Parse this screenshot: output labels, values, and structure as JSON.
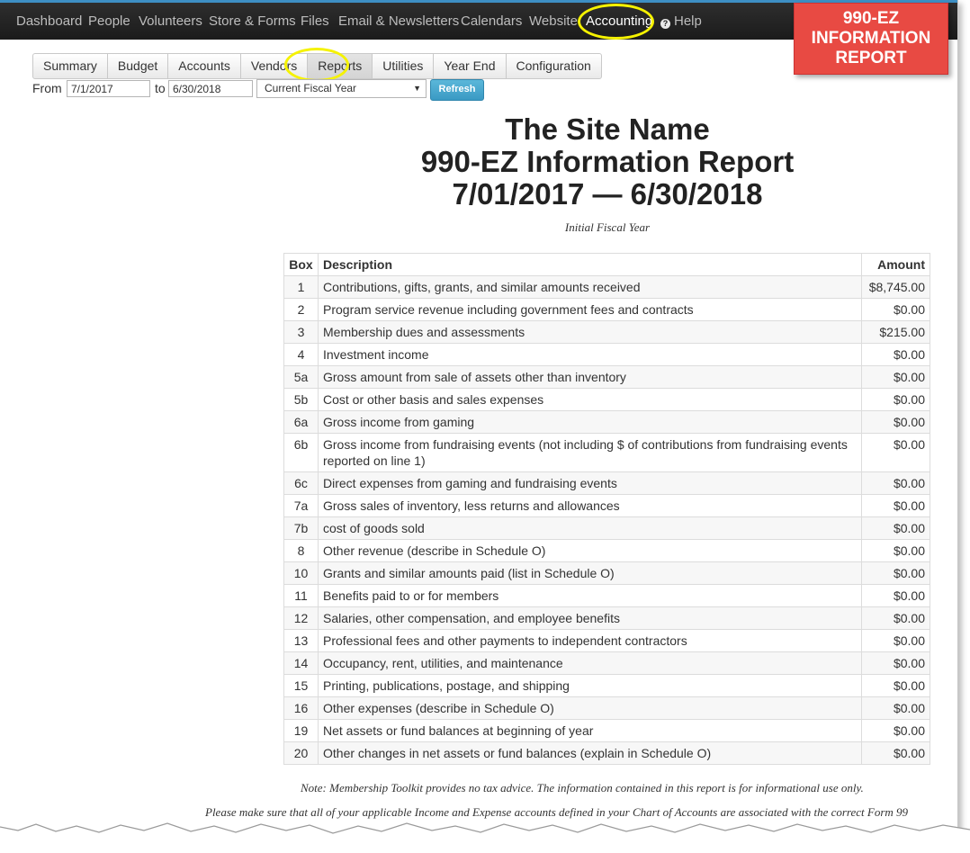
{
  "topnav": {
    "items": [
      {
        "label": "Dashboard"
      },
      {
        "label": "People"
      },
      {
        "label": "Volunteers"
      },
      {
        "label": "Store & Forms"
      },
      {
        "label": "Files"
      },
      {
        "label": "Email & Newsletters"
      },
      {
        "label": "Calendars"
      },
      {
        "label": "Website"
      },
      {
        "label": "Accounting",
        "active": true
      },
      {
        "label": "Help"
      }
    ]
  },
  "callout": {
    "line1": "990-EZ",
    "line2": "INFORMATION",
    "line3": "REPORT",
    "color": "#e84a43"
  },
  "subtabs": [
    {
      "label": "Summary"
    },
    {
      "label": "Budget"
    },
    {
      "label": "Accounts"
    },
    {
      "label": "Vendors"
    },
    {
      "label": "Reports",
      "active": true
    },
    {
      "label": "Utilities"
    },
    {
      "label": "Year End"
    },
    {
      "label": "Configuration"
    }
  ],
  "filter": {
    "from_label": "From",
    "from_value": "7/1/2017",
    "to_label": "to",
    "to_value": "6/30/2018",
    "period_selected": "Current Fiscal Year",
    "refresh_label": "Refresh",
    "refresh_color": "#3a9ac4"
  },
  "report": {
    "site_name": "The Site Name",
    "title": "990-EZ Information Report",
    "date_range": "7/01/2017 — 6/30/2018",
    "subtitle": "Initial Fiscal Year",
    "columns": {
      "box": "Box",
      "description": "Description",
      "amount": "Amount"
    },
    "rows": [
      {
        "box": "1",
        "description": "Contributions, gifts, grants, and similar amounts received",
        "amount": "$8,745.00"
      },
      {
        "box": "2",
        "description": "Program service revenue including government fees and contracts",
        "amount": "$0.00"
      },
      {
        "box": "3",
        "description": "Membership dues and assessments",
        "amount": "$215.00"
      },
      {
        "box": "4",
        "description": "Investment income",
        "amount": "$0.00"
      },
      {
        "box": "5a",
        "description": "Gross amount from sale of assets other than inventory",
        "amount": "$0.00"
      },
      {
        "box": "5b",
        "description": "Cost or other basis and sales expenses",
        "amount": "$0.00"
      },
      {
        "box": "6a",
        "description": "Gross income from gaming",
        "amount": "$0.00"
      },
      {
        "box": "6b",
        "description": "Gross income from fundraising events (not including $ of contributions from fundraising events reported on line 1)",
        "amount": "$0.00"
      },
      {
        "box": "6c",
        "description": "Direct expenses from gaming and fundraising events",
        "amount": "$0.00"
      },
      {
        "box": "7a",
        "description": "Gross sales of inventory, less returns and allowances",
        "amount": "$0.00"
      },
      {
        "box": "7b",
        "description": "cost of goods sold",
        "amount": "$0.00"
      },
      {
        "box": "8",
        "description": "Other revenue (describe in Schedule O)",
        "amount": "$0.00"
      },
      {
        "box": "10",
        "description": "Grants and similar amounts paid (list in Schedule O)",
        "amount": "$0.00"
      },
      {
        "box": "11",
        "description": "Benefits paid to or for members",
        "amount": "$0.00"
      },
      {
        "box": "12",
        "description": "Salaries, other compensation, and employee benefits",
        "amount": "$0.00"
      },
      {
        "box": "13",
        "description": "Professional fees and other payments to independent contractors",
        "amount": "$0.00"
      },
      {
        "box": "14",
        "description": "Occupancy, rent, utilities, and maintenance",
        "amount": "$0.00"
      },
      {
        "box": "15",
        "description": "Printing, publications, postage, and shipping",
        "amount": "$0.00"
      },
      {
        "box": "16",
        "description": "Other expenses (describe in Schedule O)",
        "amount": "$0.00"
      },
      {
        "box": "19",
        "description": "Net assets or fund balances at beginning of year",
        "amount": "$0.00"
      },
      {
        "box": "20",
        "description": "Other changes in net assets or fund balances (explain in Schedule O)",
        "amount": "$0.00"
      }
    ],
    "note1": "Note: Membership Toolkit provides no tax advice. The information contained in this report is for informational use only.",
    "note2": "Please make sure that all of your applicable Income and Expense accounts defined in your Chart of Accounts are associated with the correct Form 99"
  },
  "colors": {
    "highlight": "#f5f200",
    "nav_bg": "#1e1e1e",
    "nav_accent": "#3d8fc4"
  }
}
